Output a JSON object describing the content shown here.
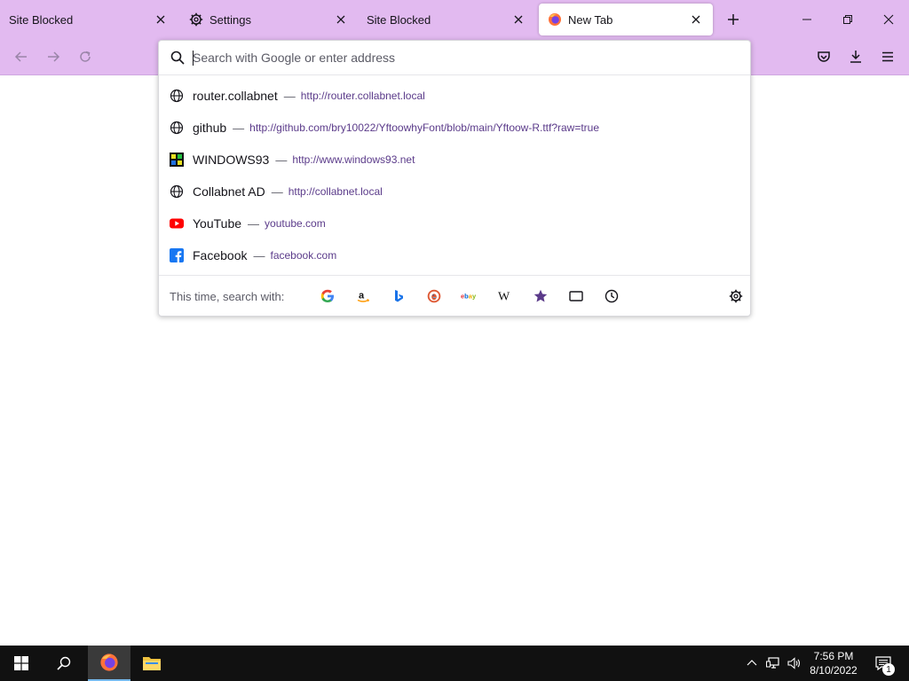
{
  "tabs": [
    {
      "label": "Site Blocked",
      "icon": "none",
      "active": false
    },
    {
      "label": "Settings",
      "icon": "gear-icon",
      "active": false
    },
    {
      "label": "Site Blocked",
      "icon": "none",
      "active": false
    },
    {
      "label": "New Tab",
      "icon": "firefox-icon",
      "active": true
    }
  ],
  "urlbar": {
    "placeholder": "Search with Google or enter address",
    "results": [
      {
        "title": "router.collabnet",
        "sep": "—",
        "url": "http://router.collabnet.local",
        "icon": "globe-icon"
      },
      {
        "title": "github",
        "sep": "—",
        "url": "http://github.com/bry10022/YftoowhyFont/blob/main/Yftoow-R.ttf?raw=true",
        "icon": "globe-icon"
      },
      {
        "title": "WINDOWS93",
        "sep": "—",
        "url": "http://www.windows93.net",
        "icon": "windows93-icon"
      },
      {
        "title": "Collabnet AD",
        "sep": "—",
        "url": "http://collabnet.local",
        "icon": "globe-icon"
      },
      {
        "title": "YouTube",
        "sep": "—",
        "url": "youtube.com",
        "icon": "youtube-icon"
      },
      {
        "title": "Facebook",
        "sep": "—",
        "url": "facebook.com",
        "icon": "facebook-icon"
      }
    ],
    "oneoff": {
      "label": "This time, search with:",
      "engines": [
        "google-icon",
        "amazon-icon",
        "bing-icon",
        "duckduckgo-icon",
        "ebay-icon",
        "wikipedia-icon",
        "bookmarks-star-icon",
        "tabs-icon",
        "history-icon"
      ]
    }
  },
  "taskbar": {
    "time": "7:56 PM",
    "date": "8/10/2022",
    "notification_count": "1"
  },
  "colors": {
    "toolbar_bg": "#e2baf0",
    "accent": "#5b3b8a",
    "taskbar_bg": "#111111"
  }
}
